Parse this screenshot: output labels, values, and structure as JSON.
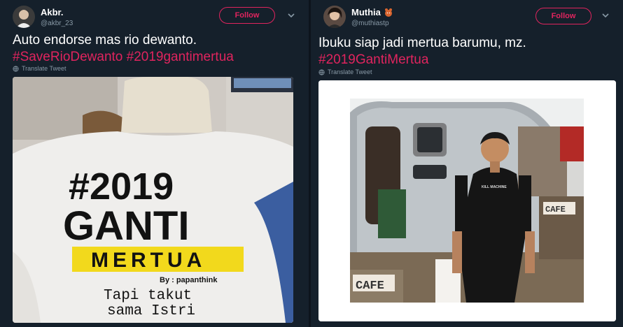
{
  "tweets": [
    {
      "display_name": "Akbr.",
      "handle": "@akbr_23",
      "follow_label": "Follow",
      "text_line1": "Auto endorse mas rio dewanto.",
      "hashtags": [
        "#SaveRioDewanto",
        "#2019gantimertua"
      ],
      "translate_label": "Translate Tweet",
      "shirt_text": {
        "line1": "#2019",
        "line2": "GANTI",
        "line3": "MERTUA",
        "by": "By : papanthink",
        "tag1": "Tapi takut",
        "tag2": "sama Istri"
      }
    },
    {
      "display_name": "Muthia",
      "handle": "@muthiastp",
      "follow_label": "Follow",
      "text_line1": "Ibuku siap jadi mertua barumu, mz.",
      "hashtags": [
        "#2019GantiMertua"
      ],
      "translate_label": "Translate Tweet",
      "photo_text": {
        "shirt": "KILL MACHINE",
        "sign1": "CAFE",
        "sign2": "CAFE"
      }
    }
  ],
  "colors": {
    "background": "#15202b",
    "accent": "#e0245e",
    "secondary_text": "#8899a6"
  },
  "icons": [
    "chevron-down-icon",
    "globe-icon",
    "emoji-icon"
  ]
}
